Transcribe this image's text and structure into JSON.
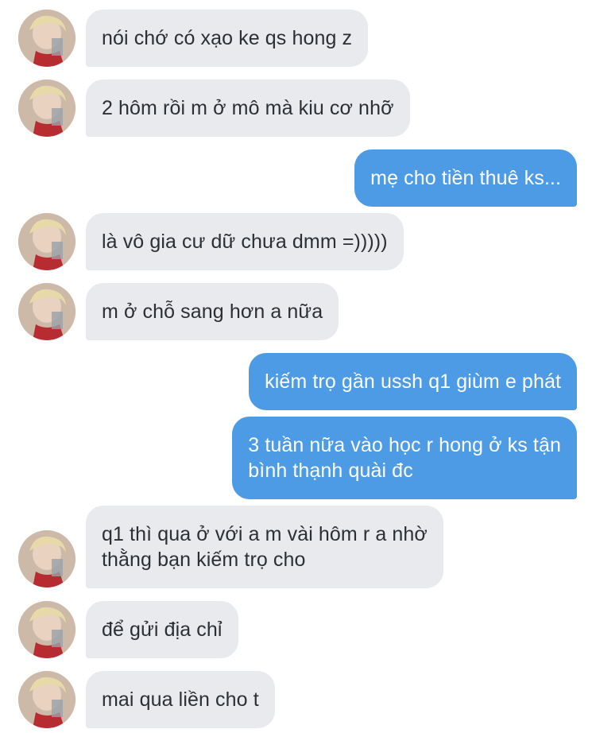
{
  "messages": [
    {
      "side": "in",
      "text": "nói chớ có xạo ke qs hong z"
    },
    {
      "side": "in",
      "text": "2 hôm rồi m ở mô mà kiu cơ nhỡ"
    },
    {
      "side": "out",
      "text": "mẹ cho tiền thuê ks..."
    },
    {
      "side": "in",
      "text": "là vô gia cư dữ chưa dmm =)))))"
    },
    {
      "side": "in",
      "text": "m ở chỗ sang hơn a nữa"
    },
    {
      "side": "out",
      "text": "kiếm trọ gần ussh q1 giùm e phát"
    },
    {
      "side": "out",
      "text": "3 tuần nữa vào học r hong ở ks tận\nbình thạnh quài đc"
    },
    {
      "side": "in",
      "text": "q1 thì qua ở với a m vài hôm r a nhờ\nthằng bạn kiếm trọ cho"
    },
    {
      "side": "in",
      "text": "để gửi địa chỉ"
    },
    {
      "side": "in",
      "text": "mai qua liền cho t"
    }
  ],
  "colors": {
    "incoming_bubble": "#e8eaee",
    "outgoing_bubble": "#4d9be5",
    "incoming_text": "#2c2f33",
    "outgoing_text": "#ffffff"
  },
  "icons": {
    "avatar": "contact-avatar-photo"
  }
}
